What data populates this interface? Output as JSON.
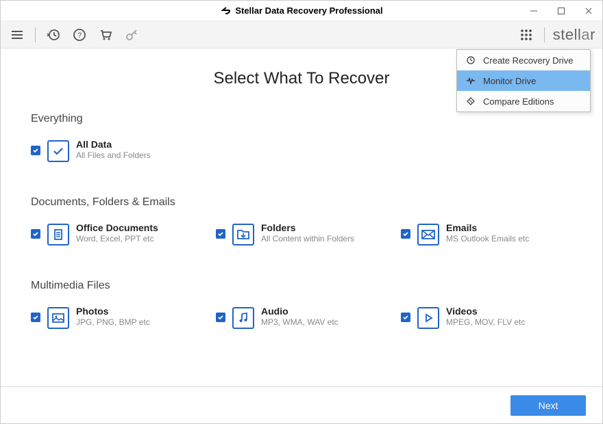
{
  "window": {
    "title": "Stellar Data Recovery Professional"
  },
  "toolbar": {
    "brand": "stellar"
  },
  "dropdown": {
    "items": [
      {
        "label": "Create Recovery Drive"
      },
      {
        "label": "Monitor Drive"
      },
      {
        "label": "Compare Editions"
      }
    ]
  },
  "heading": "Select What To Recover",
  "sections": {
    "everything": {
      "label": "Everything",
      "item": {
        "title": "All Data",
        "sub": "All Files and Folders"
      }
    },
    "documents": {
      "label": "Documents, Folders & Emails",
      "items": [
        {
          "title": "Office Documents",
          "sub": "Word, Excel, PPT etc"
        },
        {
          "title": "Folders",
          "sub": "All Content within Folders"
        },
        {
          "title": "Emails",
          "sub": "MS Outlook Emails etc"
        }
      ]
    },
    "multimedia": {
      "label": "Multimedia Files",
      "items": [
        {
          "title": "Photos",
          "sub": "JPG, PNG, BMP etc"
        },
        {
          "title": "Audio",
          "sub": "MP3, WMA, WAV etc"
        },
        {
          "title": "Videos",
          "sub": "MPEG, MOV, FLV etc"
        }
      ]
    }
  },
  "footer": {
    "next": "Next"
  }
}
